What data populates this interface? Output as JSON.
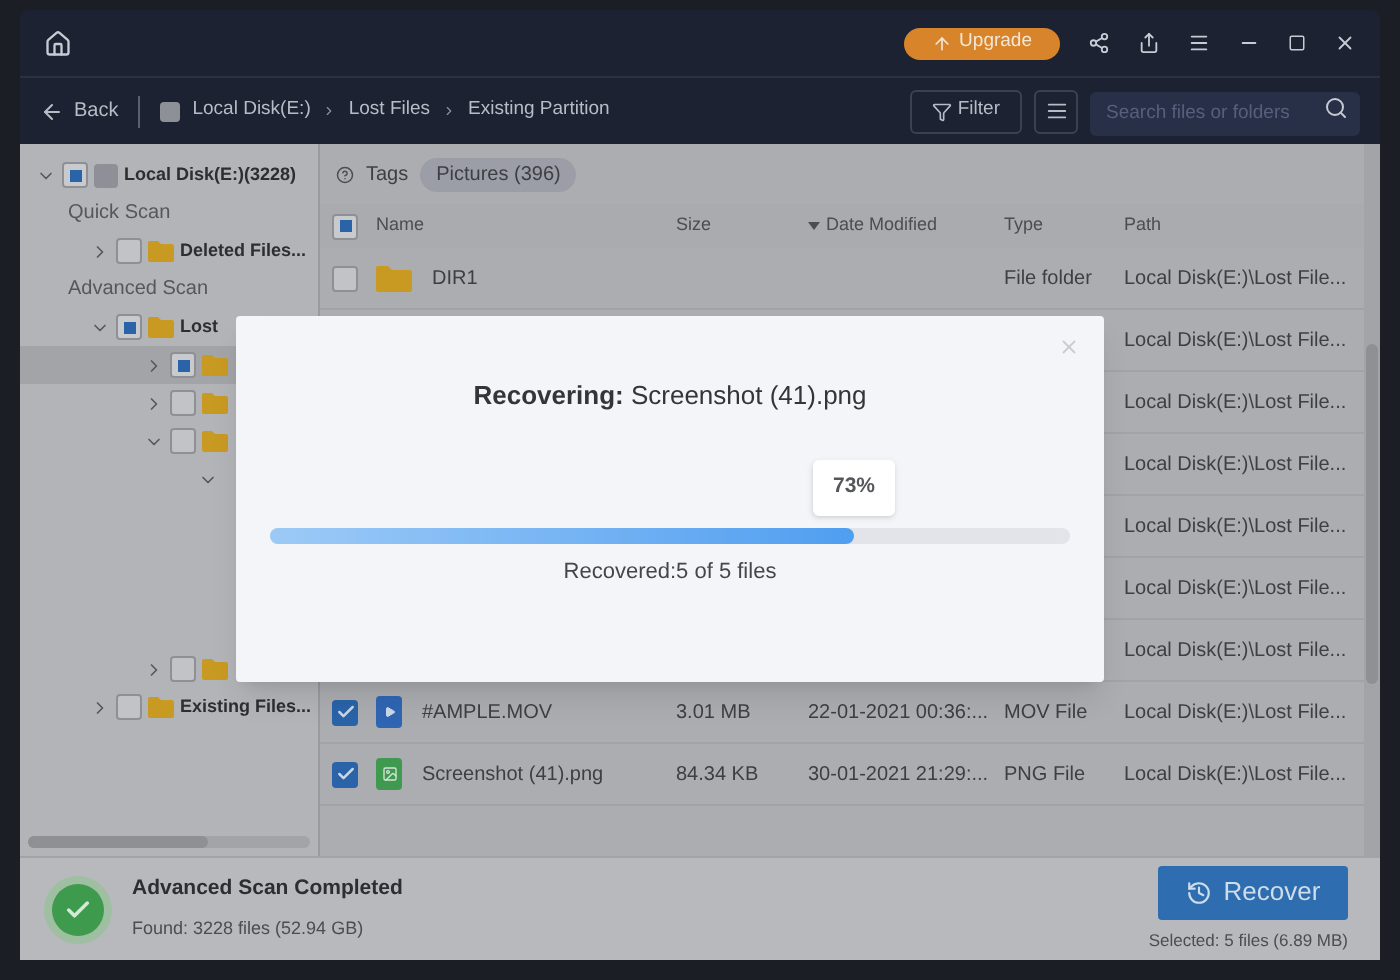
{
  "title_bar": {
    "upgrade": "Upgrade"
  },
  "nav": {
    "back": "Back",
    "breadcrumbs": [
      "Local Disk(E:)",
      "Lost Files",
      "Existing Partition"
    ],
    "filter": "Filter",
    "search": {
      "placeholder": "Search files or folders"
    }
  },
  "tree": [
    {
      "label": "Local Disk(E:)(3228)",
      "kind": "disk",
      "checked": false,
      "mixed": true,
      "expanded": true,
      "selected": false,
      "children": [
        {
          "kind": "section",
          "label": "Quick Scan"
        },
        {
          "kind": "folder",
          "label": "Deleted Files...",
          "checked": false,
          "mixed": false,
          "expanded": false,
          "selected": false
        },
        {
          "kind": "section",
          "label": "Advanced Scan"
        },
        {
          "kind": "folder",
          "label": "Lost",
          "checked": false,
          "mixed": true,
          "expanded": true,
          "selected": false,
          "children": [
            {
              "kind": "folder",
              "checked": false,
              "mixed": true,
              "expanded": false,
              "selected": true
            },
            {
              "kind": "folder",
              "checked": false,
              "mixed": false,
              "expanded": false,
              "selected": false
            },
            {
              "kind": "folder",
              "checked": false,
              "mixed": false,
              "expanded": true,
              "selected": false,
              "children": [
                {
                  "expanded": true,
                  "selected": false
                }
              ]
            },
            {
              "kind": "folder",
              "checked": false,
              "mixed": false,
              "expanded": false,
              "selected": false
            }
          ]
        },
        {
          "kind": "folder",
          "label": "Existing Files...",
          "checked": false,
          "mixed": false,
          "expanded": false,
          "selected": false
        }
      ]
    }
  ],
  "tags": {
    "label": "Tags",
    "chips": [
      {
        "label": "Pictures (396)",
        "selected": true
      }
    ]
  },
  "table": {
    "header_checked": false,
    "header_mixed": true,
    "columns": [
      "Name",
      "Size",
      "Date Modified",
      "Type",
      "Path"
    ],
    "rows": [
      {
        "kind": "folder",
        "checked": false,
        "name": "DIR1",
        "type": "File folder",
        "path": "Local Disk(E:)\\Lost File..."
      },
      {
        "kind": "hidden",
        "path": "Local Disk(E:)\\Lost File..."
      },
      {
        "kind": "hidden",
        "path": "Local Disk(E:)\\Lost File..."
      },
      {
        "kind": "hidden",
        "path": "Local Disk(E:)\\Lost File..."
      },
      {
        "kind": "hidden",
        "path": "Local Disk(E:)\\Lost File..."
      },
      {
        "kind": "hidden",
        "path": "Local Disk(E:)\\Lost File..."
      },
      {
        "kind": "hidden",
        "path": "Local Disk(E:)\\Lost File..."
      },
      {
        "kind": "video",
        "checked": true,
        "name": "#AMPLE.MOV",
        "size": "3.01 MB",
        "date": "22-01-2021 00:36:...",
        "type": "MOV File",
        "path": "Local Disk(E:)\\Lost File..."
      },
      {
        "kind": "image",
        "checked": true,
        "name": "Screenshot (41).png",
        "size": "84.34 KB",
        "date": "30-01-2021 21:29:...",
        "type": "PNG File",
        "path": "Local Disk(E:)\\Lost File..."
      }
    ]
  },
  "footer": {
    "status": "Advanced Scan Completed",
    "found": "Found: 3228 files (52.94 GB)",
    "recover": "Recover",
    "selected": "Selected: 5 files (6.89 MB)"
  },
  "dialog": {
    "title": "**Recovering:** Screenshot (41).png",
    "percent": "73%",
    "level": 0.73,
    "status": "Recovered:5 of 5 files"
  }
}
